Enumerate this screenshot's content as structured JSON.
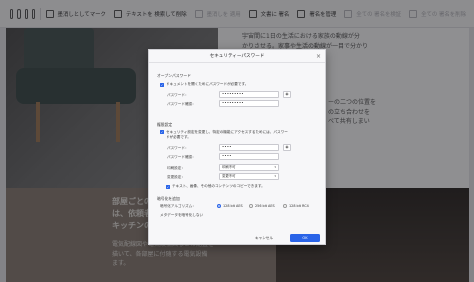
{
  "toolbar": {
    "mark_label": "墨消しとしてマーク",
    "search_label": "テキストを 検索して削除",
    "apply_label": "墨消しを 適用",
    "sign_label": "文書に 署名",
    "manage_label": "署名を管理",
    "verify_label": "全ての 署名を検証",
    "clear_label": "全ての 署名を削除"
  },
  "background": {
    "text_right_1": "宇宙間に1日の生活における家族の動線が分",
    "text_right_2": "かりさせる。家事や生活の動線が一目で分かり",
    "text_right_3": "家事の分担が円滑になる。",
    "text_right_4": "ーの二つの位置を",
    "text_right_5": "の立ち合わせを",
    "text_right_6": "べて共有しまい",
    "text_left_big_1": "部屋ごとの",
    "text_left_big_2": "は、依頼者",
    "text_left_big_3": "キッチンの",
    "text_left_small_1": "電気配線図や電気設備図などの配置を",
    "text_left_small_2": "描いて、各部屋に付随する電気設備",
    "text_left_small_3": "ます。"
  },
  "dialog": {
    "title": "セキュリティーパスワード",
    "open_section": "オープンパスワード",
    "open_check_label": "ドキュメントを開くためにパスワードが必要です。",
    "password_label": "パスワード：",
    "password_value": "•••••••••",
    "confirm_label": "パスワード確認：",
    "confirm_value": "•••••••••",
    "permission_section": "権限設定",
    "perm_check_label_1": "セキュリティ設定を変更し、特定の機能にアクセスするためには、パスワー",
    "perm_check_label_2": "ドが必要です。",
    "perm_password_label": "パスワード：",
    "perm_password_value": "••••",
    "perm_confirm_label": "パスワード確認：",
    "perm_confirm_value": "••••",
    "print_label": "印刷設定：",
    "print_value": "印刷不可",
    "change_label": "変更設定：",
    "change_value": "変更不可",
    "copy_check_label": "テキスト、画像、その他のコンテンツのコピーできます。",
    "encryption_section": "暗号化を追加",
    "algorithm_label": "暗号化アルゴリズム：",
    "algo_options": [
      "128 bit AES",
      "256 bit AES",
      "128 bit RC4"
    ],
    "algo_selected": 0,
    "metadata_label": "メタデータを暗号化しない",
    "cancel_label": "キャンセル",
    "ok_label": "OK",
    "close_glyph": "×",
    "eye_glyph": "◉",
    "chevron_glyph": "▾",
    "check_glyph": "✓"
  },
  "colors": {
    "accent": "#2a64e8",
    "overlay": "#141419"
  }
}
